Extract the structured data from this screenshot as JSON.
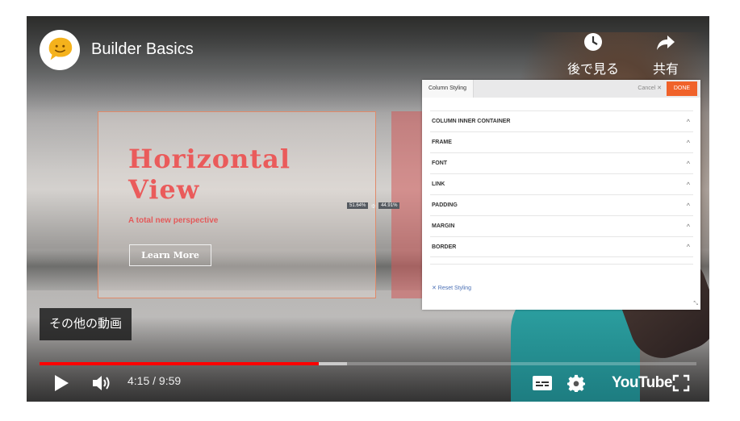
{
  "player": {
    "channel_title": "Builder Basics",
    "watch_later_label": "後で見る",
    "share_label": "共有",
    "more_videos_label": "その他の動画",
    "time_current": "4:15",
    "time_separator": " / ",
    "time_total": "9:59",
    "progress_played": 0.425,
    "progress_buffered": 0.468,
    "youtube_label": "YouTube",
    "progress_color": "#ff0000"
  },
  "video_content": {
    "heading": "Horizontal View",
    "subheading": "A total new perspective",
    "button_label": "Learn More",
    "pct_left": "51.64%",
    "pct_right": "44.91%",
    "accent_color": "#ea5b5b"
  },
  "panel": {
    "tab_label": "Column Styling",
    "cancel_label": "Cancel ✕",
    "done_label": "DONE",
    "done_color": "#f0622a",
    "rows": [
      {
        "label": "COLUMN INNER CONTAINER"
      },
      {
        "label": "FRAME"
      },
      {
        "label": "FONT"
      },
      {
        "label": "LINK"
      },
      {
        "label": "PADDING"
      },
      {
        "label": "MARGIN"
      },
      {
        "label": "BORDER"
      }
    ],
    "chevron": "^",
    "reset_label": "✕ Reset Styling",
    "resize_glyph": "⤡"
  },
  "icons": {
    "channel_logo": "speech-bubble-smiley-icon",
    "watch_later": "clock-icon",
    "share": "share-arrow-icon",
    "play": "play-icon",
    "volume": "volume-icon",
    "subtitles": "subtitles-icon",
    "settings": "gear-icon",
    "fullscreen": "fullscreen-icon"
  }
}
